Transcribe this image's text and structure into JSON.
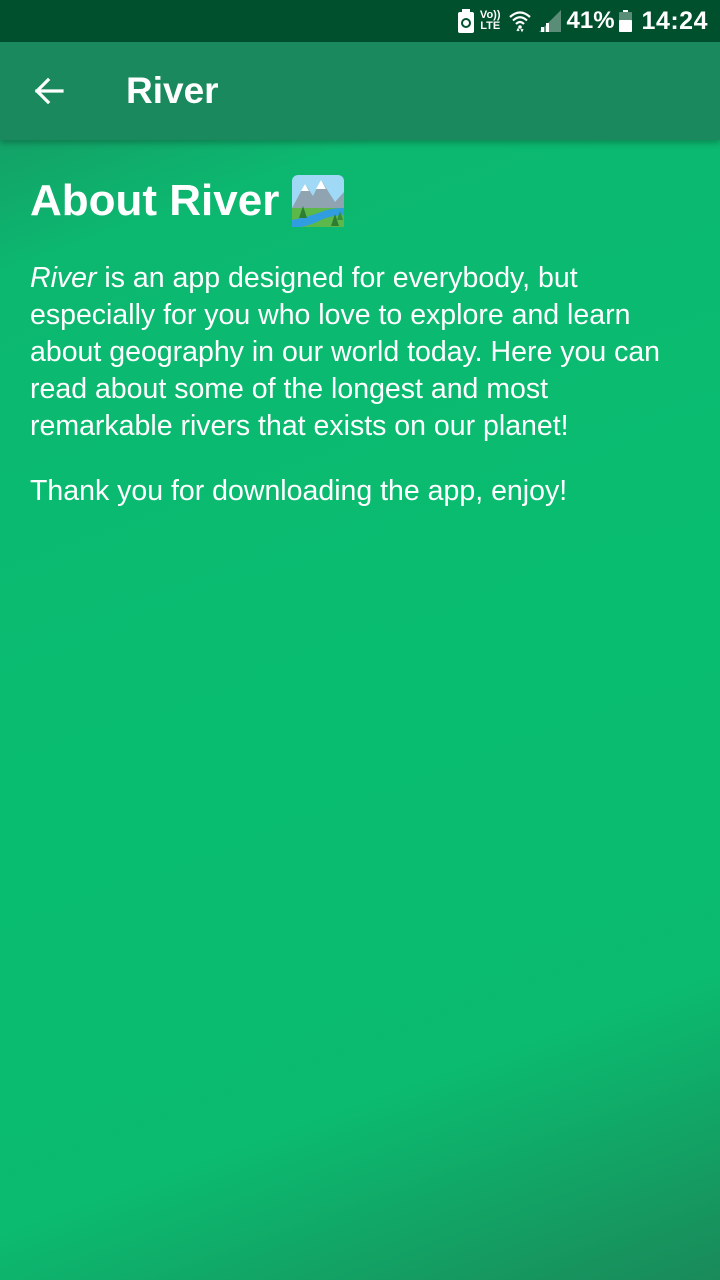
{
  "status_bar": {
    "volte_top": "Vo))",
    "volte_bottom": "LTE",
    "battery_percent": "41%",
    "time": "14:24",
    "icons": [
      "battery-saver-icon",
      "wifi-icon",
      "cellular-signal-icon",
      "battery-icon"
    ]
  },
  "app_bar": {
    "title": "River",
    "back_icon": "arrow-left-icon"
  },
  "about": {
    "title": "About River",
    "emoji_icon": "national-park-emoji-icon",
    "para1_italic": "River",
    "para1_rest": " is an app designed for everybody, but especially for you who love to explore and learn about geography in our world today. Here you can read about some of the longest and most remarkable rivers that exists on our planet!",
    "para2": "Thank you for downloading the app, enjoy!"
  },
  "colors": {
    "status_bar": "#00502e",
    "app_bar": "#1a8a5e",
    "background": "#08bd70",
    "text": "#ffffff"
  }
}
